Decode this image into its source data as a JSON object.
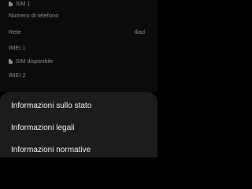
{
  "background_screen": {
    "sim1": {
      "header": "SIM 1",
      "phone_number_label": "Numero di telefono",
      "network_label": "Rete",
      "network_value": "Iliad",
      "imei_label": "IMEI 1"
    },
    "sim_available": {
      "header": "SIM disponibile",
      "imei_label": "IMEI 2"
    }
  },
  "sheet": {
    "items": [
      {
        "label": "Informazioni sullo stato"
      },
      {
        "label": "Informazioni legali"
      },
      {
        "label": "Informazioni normative"
      }
    ]
  },
  "colors": {
    "sheet_background": "#1c1c1c",
    "background": "#000000",
    "dim_text": "#8c8c8c",
    "sheet_text": "#f2f2f2"
  }
}
